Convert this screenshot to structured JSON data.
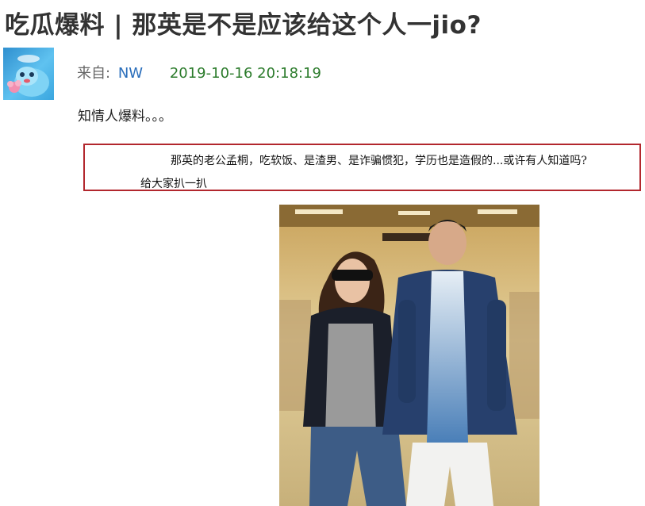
{
  "post": {
    "title": "吃瓜爆料 | 那英是不是应该给这个人一jio?",
    "meta": {
      "from_label": "来自:",
      "author": "NW",
      "datetime": "2019-10-16 20:18:19"
    },
    "body": "知情人爆料。。。",
    "quote": {
      "line1": "那英的老公孟桐，吃软饭、是渣男、是诈骗惯犯，学历也是造假的...或许有人知道吗?",
      "line2": "给大家扒一扒"
    }
  },
  "colors": {
    "title": "#333333",
    "author_link": "#2a6ebb",
    "date": "#2b7b2b",
    "quote_border": "#b2272d"
  }
}
